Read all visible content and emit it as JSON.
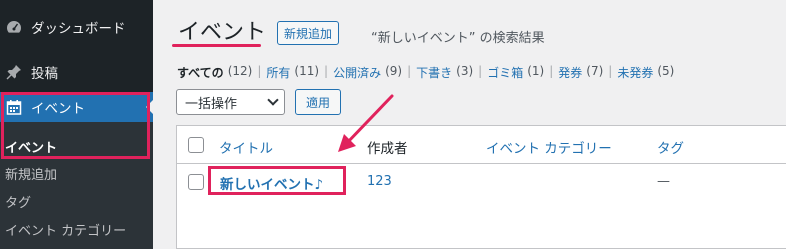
{
  "sidebar": {
    "items": [
      {
        "label": "ダッシュボード",
        "icon": "dashboard-icon"
      },
      {
        "label": "投稿",
        "icon": "pushpin-icon"
      },
      {
        "label": "イベント",
        "icon": "calendar-icon"
      }
    ],
    "submenu": [
      {
        "label": "イベント"
      },
      {
        "label": "新規追加"
      },
      {
        "label": "タグ"
      },
      {
        "label": "イベント カテゴリー"
      }
    ]
  },
  "header": {
    "title": "イベント",
    "add_new_label": "新規追加",
    "search_result": "“新しいイベント” の検索結果"
  },
  "filters": [
    {
      "label": "すべての",
      "count": "(12)"
    },
    {
      "label": "所有",
      "count": "(11)"
    },
    {
      "label": "公開済み",
      "count": "(9)"
    },
    {
      "label": "下書き",
      "count": "(3)"
    },
    {
      "label": "ゴミ箱",
      "count": "(1)"
    },
    {
      "label": "発券",
      "count": "(7)"
    },
    {
      "label": "未発券",
      "count": "(5)"
    }
  ],
  "bulk_actions": {
    "selected": "一括操作",
    "apply_label": "適用"
  },
  "table": {
    "columns": [
      "タイトル",
      "作成者",
      "イベント カテゴリー",
      "タグ"
    ],
    "rows": [
      {
        "title": "新しいイベント♪",
        "author": "123",
        "tag": "—"
      }
    ]
  },
  "colors": {
    "accent": "#2271b1",
    "highlight": "#e0225c",
    "sidebar": "#1d2327"
  }
}
